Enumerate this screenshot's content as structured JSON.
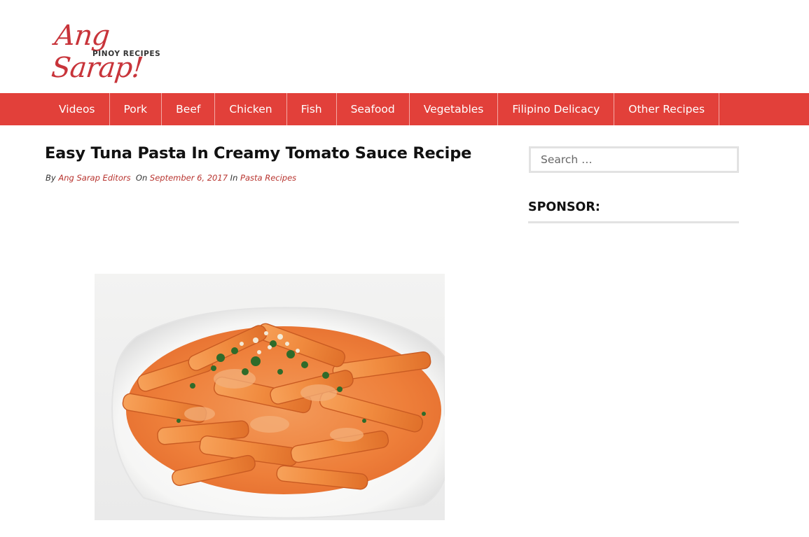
{
  "site": {
    "logo_script": "Ang Sarap!",
    "logo_subtitle": "PINOY RECIPES"
  },
  "nav": {
    "items": [
      "Videos",
      "Pork",
      "Beef",
      "Chicken",
      "Fish",
      "Seafood",
      "Vegetables",
      "Filipino Delicacy",
      "Other Recipes"
    ]
  },
  "post": {
    "title": "Easy Tuna Pasta In Creamy Tomato Sauce Recipe",
    "by_label": "By",
    "author": "Ang Sarap Editors",
    "on_label": "On",
    "date": "September 6, 2017",
    "in_label": "In",
    "category": "Pasta Recipes",
    "image_alt": "Penne pasta in creamy tomato sauce with tuna, parsley and grated cheese on a white plate"
  },
  "sidebar": {
    "search_placeholder": "Search …",
    "widget_title": "SPONSOR:"
  },
  "colors": {
    "brand_red": "#e2403a",
    "link_red": "#b8342f",
    "logo_red": "#c8343a"
  }
}
